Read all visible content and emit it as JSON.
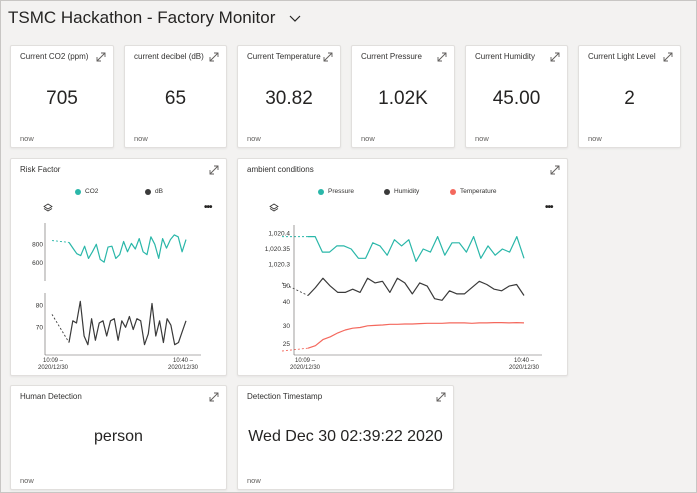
{
  "dashboard": {
    "title": "TSMC Hackathon - Factory Monitor"
  },
  "kpis": [
    {
      "title": "Current CO2 (ppm)",
      "value": "705",
      "footer": "now"
    },
    {
      "title": "current decibel (dB)",
      "value": "65",
      "footer": "now"
    },
    {
      "title": "Current Temperature",
      "value": "30.82",
      "footer": "now"
    },
    {
      "title": "Current Pressure",
      "value": "1.02K",
      "footer": "now"
    },
    {
      "title": "Current Humidity",
      "value": "45.00",
      "footer": "now"
    },
    {
      "title": "Current Light Level",
      "value": "2",
      "footer": "now"
    }
  ],
  "risk": {
    "title": "Risk Factor",
    "legend": [
      {
        "label": "CO2",
        "color": "#2ab7a9"
      },
      {
        "label": "dB",
        "color": "#3a3a3a"
      }
    ],
    "top_ticks": [
      "800",
      "600"
    ],
    "bottom_ticks": [
      "80",
      "70"
    ],
    "x_ticks": [
      {
        "time": "10:09 –",
        "date": "2020/12/30"
      },
      {
        "time": "10:40 –",
        "date": "2020/12/30"
      }
    ]
  },
  "ambient": {
    "title": "ambient conditions",
    "legend": [
      {
        "label": "Pressure",
        "color": "#2ab7a9"
      },
      {
        "label": "Humidity",
        "color": "#3a3a3a"
      },
      {
        "label": "Temperature",
        "color": "#f4685d"
      }
    ],
    "pressure_ticks": [
      "1,020.4",
      "1,020.35",
      "1,020.3"
    ],
    "humidity_ticks": [
      "50",
      "40"
    ],
    "temperature_ticks": [
      "30",
      "25"
    ],
    "x_ticks": [
      {
        "time": "10:09 –",
        "date": "2020/12/30"
      },
      {
        "time": "10:40 –",
        "date": "2020/12/30"
      }
    ]
  },
  "human": {
    "title": "Human Detection",
    "value": "person",
    "footer": "now"
  },
  "timestamp": {
    "title": "Detection Timestamp",
    "value": "Wed Dec 30 02:39:22 2020",
    "footer": "now"
  },
  "chart_data": [
    {
      "type": "line",
      "title": "Risk Factor",
      "x": [
        "10:09",
        "10:40"
      ],
      "series": [
        {
          "name": "CO2",
          "y_ticks": [
            600,
            800
          ],
          "color": "#2ab7a9",
          "values": [
            820,
            760,
            700,
            680,
            780,
            650,
            720,
            800,
            640,
            610,
            770,
            780,
            650,
            690,
            830,
            720,
            810,
            750,
            860,
            720,
            690,
            880,
            800,
            650,
            860,
            760,
            850,
            900,
            880,
            720,
            850
          ]
        },
        {
          "name": "dB",
          "y_ticks": [
            70,
            80
          ],
          "color": "#3a3a3a",
          "values": [
            63,
            73,
            72,
            82,
            66,
            62,
            74,
            64,
            72,
            73,
            66,
            73,
            74,
            64,
            73,
            70,
            75,
            69,
            74,
            73,
            62,
            67,
            81,
            66,
            73,
            63,
            74,
            71,
            62,
            63,
            68,
            73
          ]
        }
      ]
    },
    {
      "type": "line",
      "title": "ambient conditions",
      "x": [
        "10:09",
        "10:40"
      ],
      "series": [
        {
          "name": "Pressure",
          "y_ticks": [
            1020.3,
            1020.35,
            1020.4
          ],
          "color": "#2ab7a9",
          "values": [
            1020.39,
            1020.39,
            1020.34,
            1020.34,
            1020.36,
            1020.36,
            1020.35,
            1020.32,
            1020.32,
            1020.37,
            1020.36,
            1020.33,
            1020.38,
            1020.36,
            1020.38,
            1020.31,
            1020.35,
            1020.34,
            1020.39,
            1020.33,
            1020.37,
            1020.37,
            1020.34,
            1020.39,
            1020.32,
            1020.36,
            1020.33,
            1020.35,
            1020.34,
            1020.39,
            1020.32
          ]
        },
        {
          "name": "Humidity",
          "y_ticks": [
            40,
            50
          ],
          "color": "#3a3a3a",
          "values": [
            44,
            49,
            55,
            50,
            46,
            46,
            48,
            46,
            55,
            52,
            53,
            46,
            55,
            52,
            45,
            52,
            50,
            42,
            41,
            47,
            45,
            45,
            49,
            53,
            51,
            48,
            47,
            50,
            51,
            44
          ]
        },
        {
          "name": "Temperature",
          "y_ticks": [
            25,
            30
          ],
          "color": "#f4685d",
          "values": [
            23.8,
            24.5,
            26.2,
            27.0,
            28.1,
            28.9,
            29.4,
            29.6,
            30.1,
            30.2,
            30.3,
            30.5,
            30.5,
            30.6,
            30.6,
            30.7,
            30.8,
            30.8,
            30.8,
            30.9,
            30.9,
            30.9,
            30.8,
            30.9,
            30.9,
            31.0,
            31.0,
            30.9,
            31.0,
            30.9
          ]
        }
      ]
    }
  ]
}
